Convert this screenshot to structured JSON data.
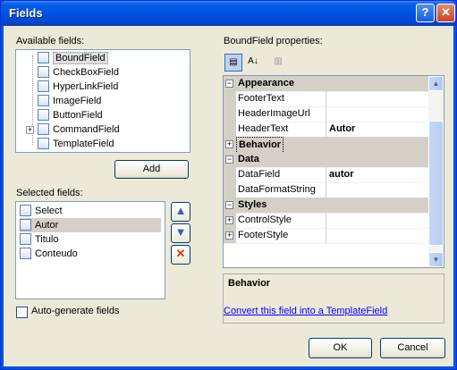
{
  "window": {
    "title": "Fields"
  },
  "available": {
    "label": "Available fields:",
    "items": [
      "BoundField",
      "CheckBoxField",
      "HyperLinkField",
      "ImageField",
      "ButtonField",
      "CommandField",
      "TemplateField"
    ],
    "add_label": "Add"
  },
  "selected": {
    "label": "Selected fields:",
    "items": [
      "Select",
      "Autor",
      "Titulo",
      "Conteudo"
    ]
  },
  "autogen": {
    "label": "Auto-generate fields",
    "checked": false
  },
  "properties": {
    "label": "BoundField properties:",
    "rows": [
      {
        "type": "category",
        "name": "Appearance",
        "expanded": true
      },
      {
        "type": "prop",
        "name": "FooterText",
        "value": ""
      },
      {
        "type": "prop",
        "name": "HeaderImageUrl",
        "value": ""
      },
      {
        "type": "prop",
        "name": "HeaderText",
        "value": "Autor"
      },
      {
        "type": "category",
        "name": "Behavior",
        "expanded": false
      },
      {
        "type": "category",
        "name": "Data",
        "expanded": true
      },
      {
        "type": "prop",
        "name": "DataField",
        "value": "autor"
      },
      {
        "type": "prop",
        "name": "DataFormatString",
        "value": ""
      },
      {
        "type": "category",
        "name": "Styles",
        "expanded": true
      },
      {
        "type": "subprop",
        "name": "ControlStyle",
        "value": ""
      },
      {
        "type": "subprop",
        "name": "FooterStyle",
        "value": ""
      }
    ],
    "description_title": "Behavior"
  },
  "convert_link": "Convert this field into a TemplateField",
  "ok_label": "OK",
  "cancel_label": "Cancel"
}
